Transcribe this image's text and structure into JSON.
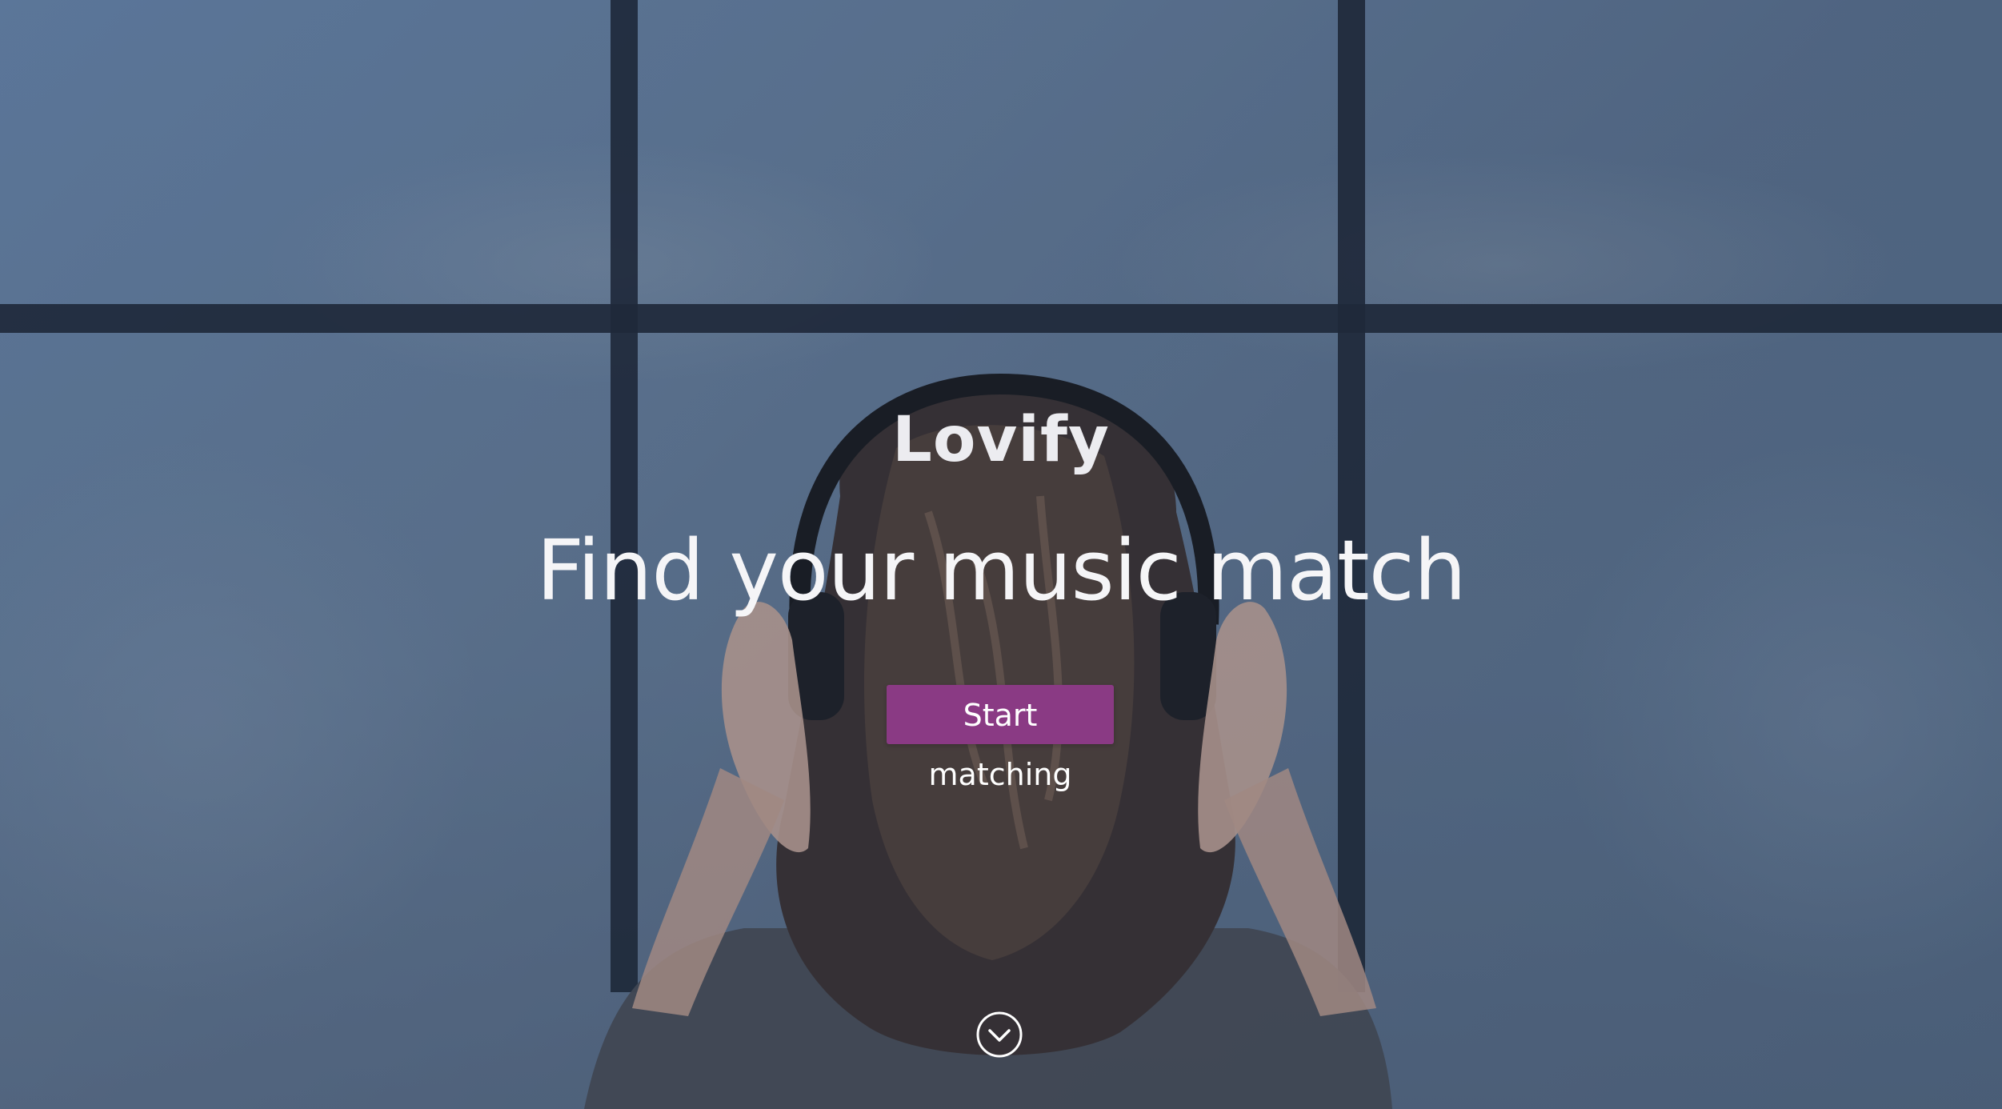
{
  "brand": {
    "name": "Lovify"
  },
  "hero": {
    "headline": "Find your music match",
    "cta_label": "Start matching",
    "accent_color": "#8a3a84"
  },
  "icons": {
    "scroll_down": "chevron-down-circle-icon"
  }
}
